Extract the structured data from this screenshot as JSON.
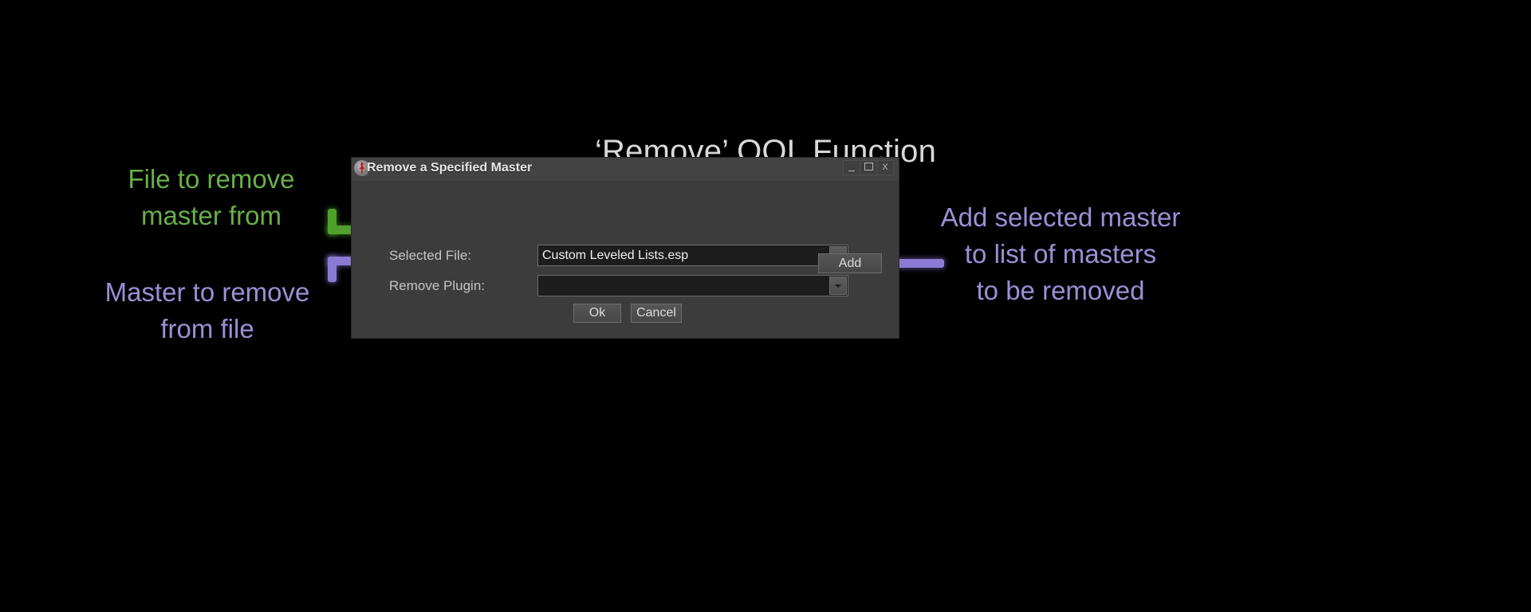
{
  "page": {
    "heading": "‘Remove’ QOL Function",
    "background_color": "#000000"
  },
  "dialog": {
    "titlebar": {
      "title": "Remove a Specified Master",
      "icon": "skyrim-dragon-icon",
      "minimize_label": "_",
      "maximize_label": "□",
      "close_label": "X"
    },
    "fields": [
      {
        "label": "Selected File:",
        "value": "Custom Leveled Lists.esp",
        "placeholder": "",
        "arrow_icon": "chevron-down-icon"
      },
      {
        "label": "Remove Plugin:",
        "value": "",
        "placeholder": "",
        "arrow_icon": "chevron-down-icon"
      }
    ],
    "buttons": {
      "add": "Add",
      "ok": "Ok",
      "cancel": "Cancel"
    }
  },
  "annotations": [
    {
      "id": "file-to-remove-master-from",
      "text": "File to remove\nmaster from",
      "color": "#68b048"
    },
    {
      "id": "master-to-remove-from-file",
      "text": "Master to remove\nfrom file",
      "color": "#9b8fd6"
    },
    {
      "id": "add-selected-master",
      "text": "Add selected master\nto list of masters\nto be removed",
      "color": "#9b8fd6"
    }
  ]
}
